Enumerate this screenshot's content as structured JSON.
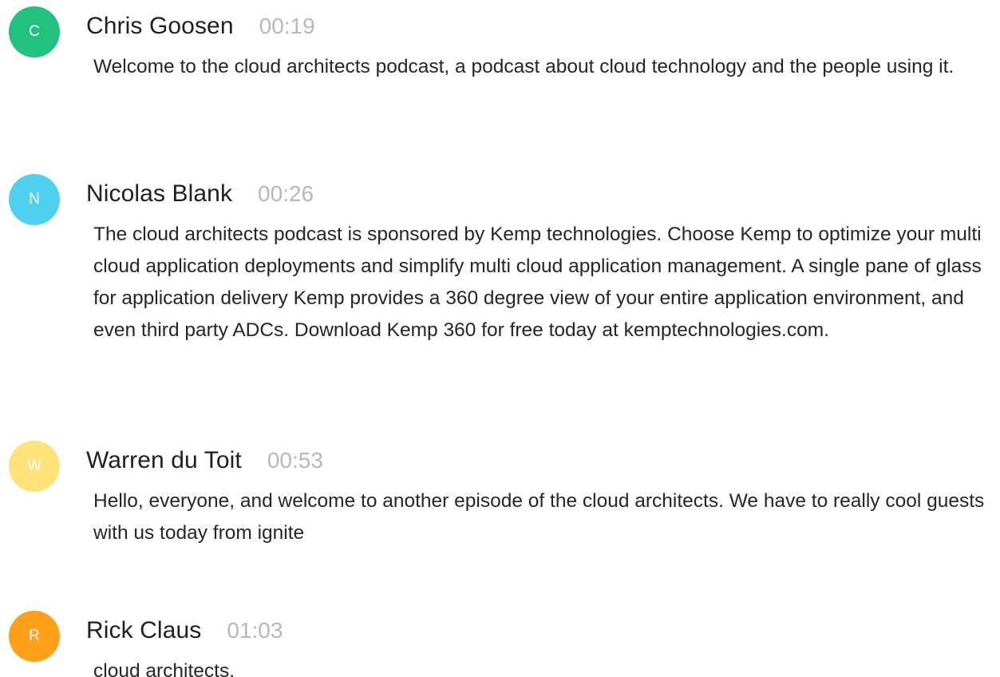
{
  "entries": [
    {
      "initial": "C",
      "color": "#22c17f",
      "speaker": "Chris Goosen",
      "time": "00:19",
      "text": "Welcome to the cloud architects podcast, a podcast about cloud technology and the people using it."
    },
    {
      "initial": "N",
      "color": "#4fd0ee",
      "speaker": "Nicolas Blank",
      "time": "00:26",
      "text": "The cloud architects podcast is sponsored by Kemp technologies. Choose Kemp to optimize your multi cloud application deployments and simplify multi cloud application management. A single pane of glass for application delivery Kemp provides a 360 degree view of your entire application environment, and even third party ADCs. Download Kemp 360 for free today at kemptechnologies.com."
    },
    {
      "initial": "W",
      "color": "#ffe27a",
      "speaker": "Warren du Toit",
      "time": "00:53",
      "text": "Hello, everyone, and welcome to another episode of the cloud architects. We have to really cool guests with us today from ignite"
    },
    {
      "initial": "R",
      "color": "#ff9f1a",
      "speaker": "Rick Claus",
      "time": "01:03",
      "text": "cloud architects."
    }
  ]
}
